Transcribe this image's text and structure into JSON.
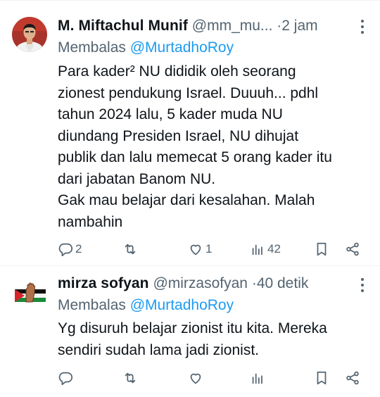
{
  "tweets": [
    {
      "name": "M. Miftachul Munif",
      "handle": "@mm_mu...",
      "separator": "·",
      "time": "2 jam",
      "reply_prefix": "Membalas",
      "reply_mention": "@MurtadhoRoy",
      "lines": [
        "Para kader² NU dididik oleh seorang",
        "zionest pendukung Israel. Duuuh... pdhl",
        "tahun 2024 lalu, 5 kader muda NU",
        "diundang Presiden Israel, NU dihujat",
        "publik dan lalu memecat 5 orang kader itu",
        "dari jabatan Banom NU.",
        "Gak mau belajar dari kesalahan. Malah",
        "nambahin"
      ],
      "stats": {
        "replies": "2",
        "reposts": "",
        "likes": "1",
        "views": "42"
      }
    },
    {
      "name": "mirza sofyan",
      "handle": "@mirzasofyan",
      "separator": "·",
      "time": "40 detik",
      "reply_prefix": "Membalas",
      "reply_mention": "@MurtadhoRoy",
      "lines": [
        "Yg disuruh belajar zionist itu kita. Mereka",
        "sendiri sudah lama jadi zionist."
      ],
      "stats": {
        "replies": "",
        "reposts": "",
        "likes": "",
        "views": ""
      }
    }
  ],
  "icons": [
    "reply-icon",
    "repost-icon",
    "like-icon",
    "views-icon",
    "bookmark-icon",
    "share-icon",
    "more-icon"
  ],
  "colors": {
    "text": "#0f1419",
    "secondary": "#536471",
    "link": "#1d9bf0",
    "divider": "#eff3f4"
  }
}
